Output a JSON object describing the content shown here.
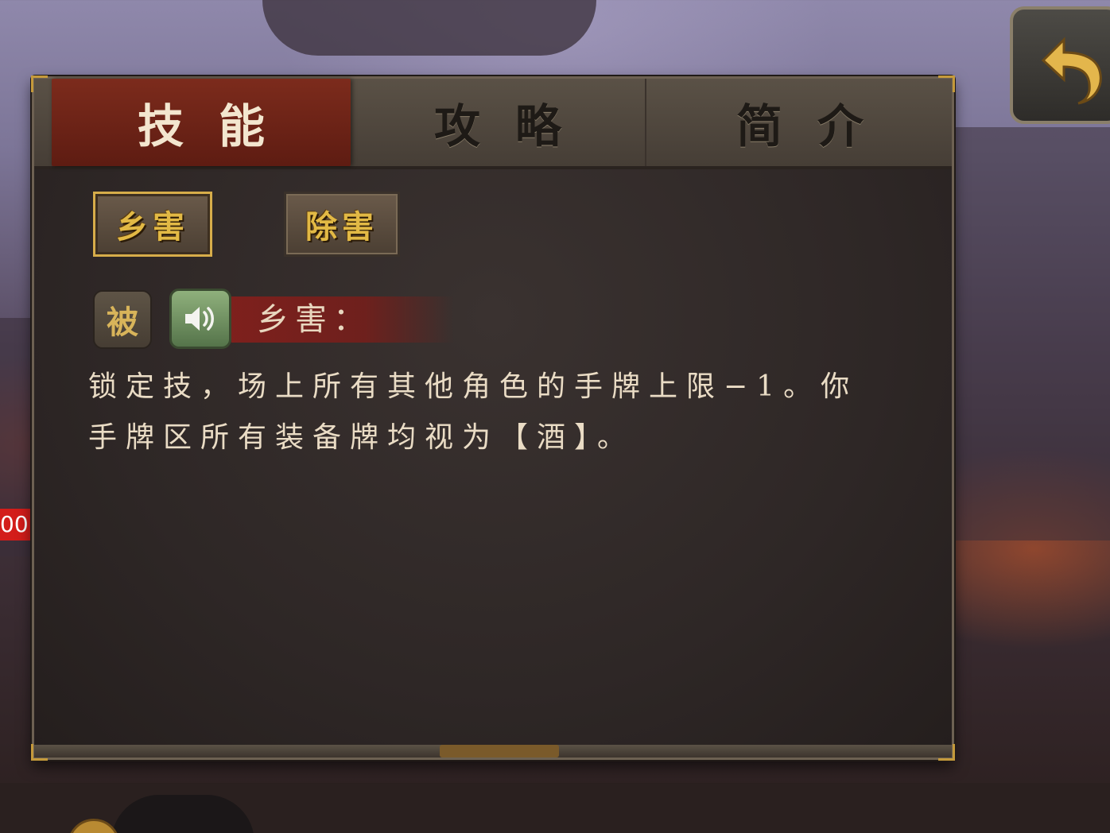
{
  "tabs": [
    {
      "label": "技能",
      "active": true
    },
    {
      "label": "攻略",
      "active": false
    },
    {
      "label": "简介",
      "active": false
    }
  ],
  "skills": [
    {
      "label": "乡害",
      "selected": true
    },
    {
      "label": "除害",
      "selected": false
    }
  ],
  "current_skill": {
    "type_badge": "被",
    "name": "乡害：",
    "description_lines": [
      "锁定技，场上所有其他角色的手牌上限−1。你",
      "手牌区所有装备牌均视为【酒】。"
    ]
  },
  "side_tag": "00",
  "icons": {
    "back": "back-arrow-icon",
    "voice": "speaker-icon"
  },
  "colors": {
    "active_tab": "#7c2b1c",
    "gold": "#e2b945",
    "voice_green": "#6f9160"
  }
}
